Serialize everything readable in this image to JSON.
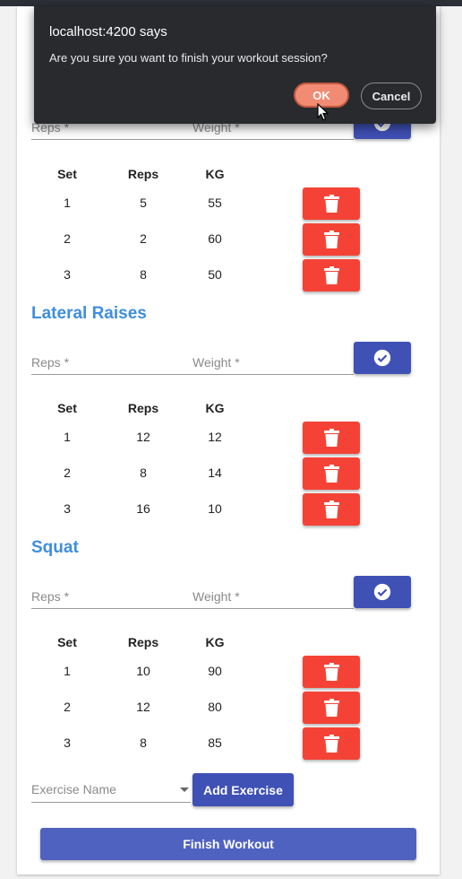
{
  "dialog": {
    "title": "localhost:4200 says",
    "message": "Are you sure you want to finish your workout session?",
    "ok_label": "OK",
    "cancel_label": "Cancel"
  },
  "table_headers": {
    "set": "Set",
    "reps": "Reps",
    "kg": "KG"
  },
  "input_placeholders": {
    "reps": "Reps *",
    "weight": "Weight *"
  },
  "exercises": [
    {
      "name": "",
      "rows": [
        {
          "set": "1",
          "reps": "5",
          "kg": "55"
        },
        {
          "set": "2",
          "reps": "2",
          "kg": "60"
        },
        {
          "set": "3",
          "reps": "8",
          "kg": "50"
        }
      ]
    },
    {
      "name": "Lateral Raises",
      "rows": [
        {
          "set": "1",
          "reps": "12",
          "kg": "12"
        },
        {
          "set": "2",
          "reps": "8",
          "kg": "14"
        },
        {
          "set": "3",
          "reps": "16",
          "kg": "10"
        }
      ]
    },
    {
      "name": "Squat",
      "rows": [
        {
          "set": "1",
          "reps": "10",
          "kg": "90"
        },
        {
          "set": "2",
          "reps": "12",
          "kg": "80"
        },
        {
          "set": "3",
          "reps": "8",
          "kg": "85"
        }
      ]
    }
  ],
  "exercise_select": {
    "placeholder": "Exercise Name"
  },
  "add_exercise_label": "Add Exercise",
  "finish_label": "Finish Workout",
  "colors": {
    "primary": "#3f51b5",
    "danger": "#f44336",
    "title_blue": "#3f8edd",
    "dialog_bg": "#292a2d",
    "ok_button": "#f28b73"
  },
  "icons": [
    "check-circle-icon",
    "trash-icon",
    "chevron-down-icon",
    "mouse-cursor-icon"
  ]
}
